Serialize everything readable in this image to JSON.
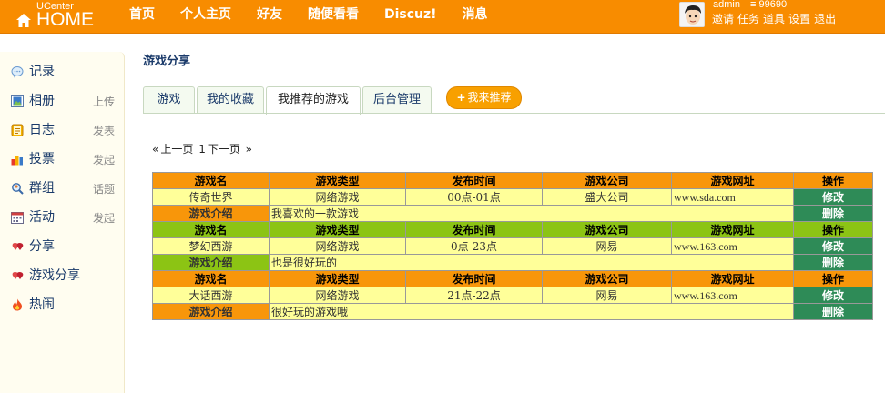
{
  "header": {
    "logo_top": "UCenter",
    "logo_main": "HOME",
    "nav": [
      "首页",
      "个人主页",
      "好友",
      "随便看看",
      "Discuz!",
      "消息"
    ],
    "user": {
      "name": "admin",
      "score": "99690",
      "links": [
        "邀请",
        "任务",
        "道具",
        "设置",
        "退出"
      ]
    }
  },
  "sidebar": {
    "items": [
      {
        "label": "记录",
        "extra": "",
        "icon": "record-icon"
      },
      {
        "label": "相册",
        "extra": "上传",
        "icon": "album-icon"
      },
      {
        "label": "日志",
        "extra": "发表",
        "icon": "blog-icon"
      },
      {
        "label": "投票",
        "extra": "发起",
        "icon": "poll-icon"
      },
      {
        "label": "群组",
        "extra": "话题",
        "icon": "group-icon"
      },
      {
        "label": "活动",
        "extra": "发起",
        "icon": "event-icon"
      },
      {
        "label": "分享",
        "extra": "",
        "icon": "share-icon"
      },
      {
        "label": "游戏分享",
        "extra": "",
        "icon": "game-share-icon"
      },
      {
        "label": "热闹",
        "extra": "",
        "icon": "hot-icon"
      }
    ]
  },
  "main": {
    "title": "游戏分享",
    "tabs": [
      "游戏",
      "我的收藏",
      "我推荐的游戏",
      "后台管理"
    ],
    "recommend_button": "我来推荐",
    "pager": {
      "prev_mark": "«",
      "prev": "上一页",
      "page": "1",
      "next": "下一页",
      "next_mark": "»"
    },
    "table": {
      "headers": [
        "游戏名",
        "游戏类型",
        "发布时间",
        "游戏公司",
        "游戏网址",
        "操作"
      ],
      "intro_label": "游戏介绍",
      "edit_label": "修改",
      "delete_label": "删除",
      "rows": [
        {
          "name": "传奇世界",
          "type": "网络游戏",
          "time": "00点-01点",
          "company": "盛大公司",
          "url": "www.sda.com",
          "intro": "我喜欢的一款游戏",
          "header_color": "#f8960a"
        },
        {
          "name": "梦幻西游",
          "type": "网络游戏",
          "time": "0点-23点",
          "company": "网易",
          "url": "www.163.com",
          "intro": "也是很好玩的",
          "header_color": "#8cc414"
        },
        {
          "name": "大话西游",
          "type": "网络游戏",
          "time": "21点-22点",
          "company": "网易",
          "url": "www.163.com",
          "intro": "很好玩的游戏哦",
          "header_color": "#f8960a"
        }
      ]
    }
  },
  "colors": {
    "topbar": "#f88c00",
    "operation": "#2e8b57",
    "cell": "#ffff99"
  }
}
